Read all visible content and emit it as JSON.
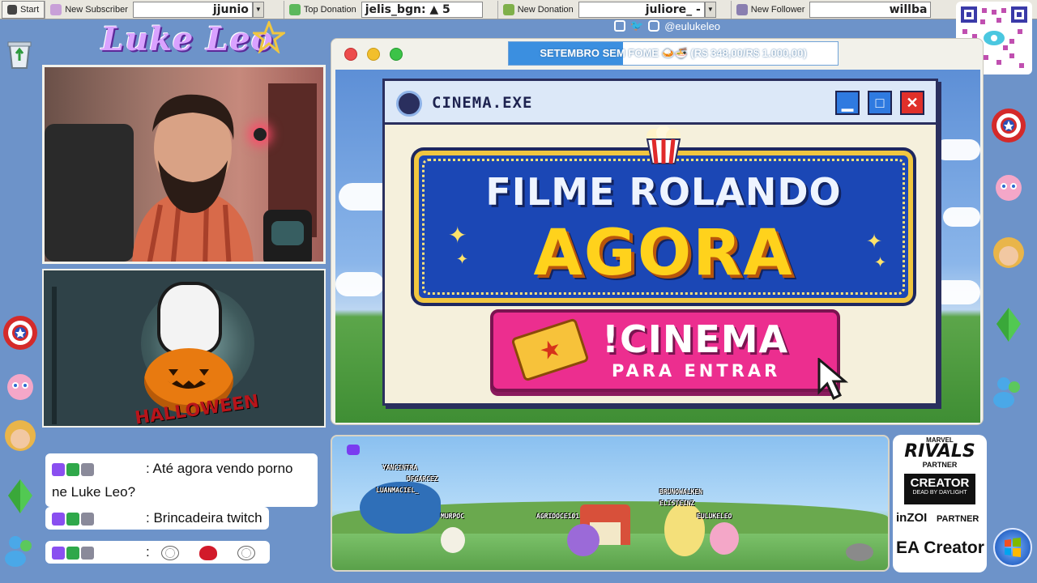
{
  "taskbar": {
    "start_label": "Start",
    "items": [
      {
        "label": "New Subscriber",
        "value": "jjunio"
      },
      {
        "label": "Top Donation",
        "value": "jelis_bgn:  ▲ 5"
      },
      {
        "label": "New Donation",
        "value": "juliore_ -"
      },
      {
        "label": "New Follower",
        "value": "willba"
      }
    ]
  },
  "channel": {
    "logo_text": "Luke Leo",
    "social_handle": "@eulukeleo"
  },
  "goal": {
    "label": "SETEMBRO SEM FOME 🍛🍜 (R$ 348,00/R$ 1.000,00)",
    "progress": 0.348
  },
  "cinema_window": {
    "title": "CINEMA.EXE",
    "minimize_label": "▁",
    "maximize_label": "□",
    "close_label": "✕",
    "headline_top": "FILME ROLANDO",
    "headline_bottom": "AGORA",
    "cta_command": "!CINEMA",
    "cta_sub": "PARA ENTRAR"
  },
  "halloween": {
    "title": "HALLOWEEN"
  },
  "chat": {
    "messages": [
      {
        "text": ": Até agora vendo porno ne Luke Leo?"
      },
      {
        "text": ": Brincadeira twitch"
      },
      {
        "text": ":"
      }
    ]
  },
  "stream_pets": {
    "names": [
      "YANCINTRA",
      "DFGARCEZ",
      "LUANMACIEL_",
      "MURPOC",
      "AGRIDOCE101",
      "BRUNOWALKEN",
      "ELISTEINZ",
      "EULUKELEO"
    ]
  },
  "partner": {
    "marvel_rivals": "RIVALS",
    "marvel_top": "MARVEL",
    "marvel_partner": "PARTNER",
    "creator": "CREATOR",
    "dbd": "DEAD BY DAYLIGHT",
    "inzoi": "inZOI",
    "inzoi_partner": "PARTNER",
    "ea_creator": "EA Creator"
  },
  "colors": {
    "background": "#6d93c9",
    "accent_pink": "#ec2e8f",
    "marquee_blue": "#1b47b5",
    "marquee_yellow": "#ffd21c",
    "goal_blue": "#3b8fe0"
  }
}
